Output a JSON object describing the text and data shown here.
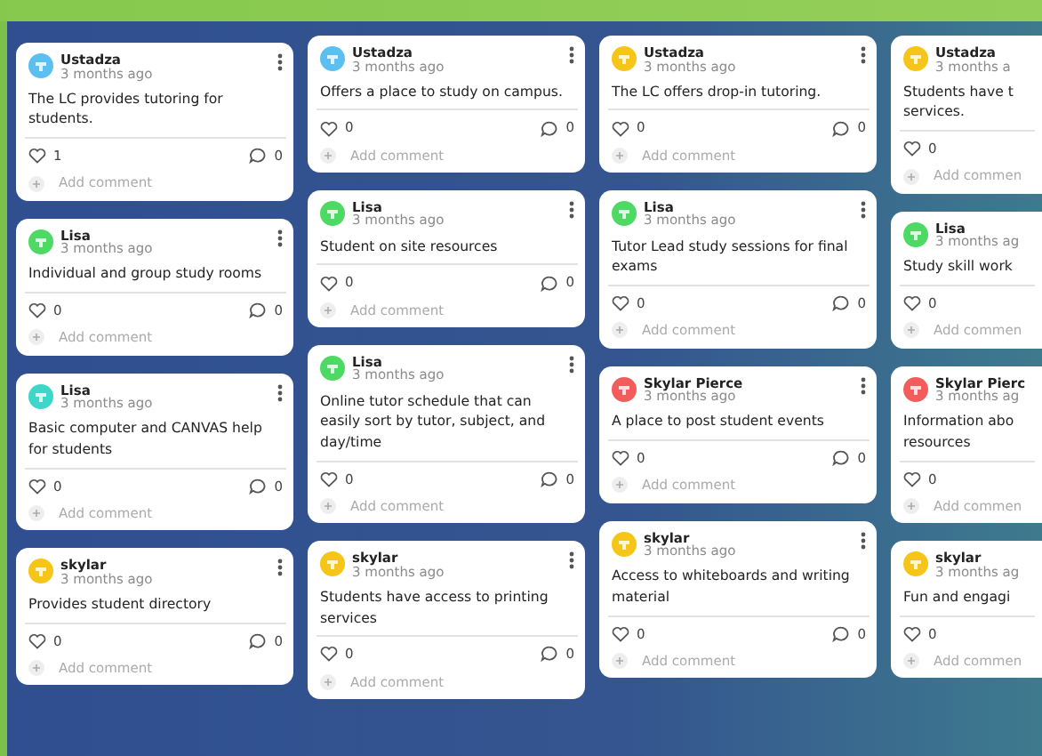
{
  "columns": [
    {
      "posts": [
        {
          "author": "Ustadza",
          "time": "3 months ago",
          "color": "#5bc0f0",
          "text": "The LC provides tutoring for students.",
          "likes": "1",
          "comments": "0",
          "add_comment": "Add comment",
          "menu": true
        },
        {
          "author": "Lisa",
          "time": "3 months ago",
          "color": "#4cd964",
          "text": "Individual and group study rooms",
          "likes": "0",
          "comments": "0",
          "add_comment": "Add comment",
          "menu": true
        },
        {
          "author": "Lisa",
          "time": "3 months ago",
          "color": "#3ed6c8",
          "text": "Basic computer and CANVAS help for students",
          "likes": "0",
          "comments": "0",
          "add_comment": "Add comment",
          "menu": true
        },
        {
          "author": "skylar",
          "time": "3 months ago",
          "color": "#f5c518",
          "text": "Provides student directory",
          "likes": "0",
          "comments": "0",
          "add_comment": "Add comment",
          "menu": true
        }
      ]
    },
    {
      "posts": [
        {
          "author": "Ustadza",
          "time": "3 months ago",
          "color": "#5bc0f0",
          "text": "Offers a place to study on campus.",
          "likes": "0",
          "comments": "0",
          "add_comment": "Add comment",
          "menu": true
        },
        {
          "author": "Lisa",
          "time": "3 months ago",
          "color": "#4cd964",
          "text": "Student on site resources",
          "likes": "0",
          "comments": "0",
          "add_comment": "Add comment",
          "menu": true
        },
        {
          "author": "Lisa",
          "time": "3 months ago",
          "color": "#4cd964",
          "text": "Online tutor schedule that can easily sort by tutor, subject, and day/time",
          "likes": "0",
          "comments": "0",
          "add_comment": "Add comment",
          "menu": true
        },
        {
          "author": "skylar",
          "time": "3 months ago",
          "color": "#f5c518",
          "text": "Students have access to printing services",
          "likes": "0",
          "comments": "0",
          "add_comment": "Add comment",
          "menu": true
        }
      ]
    },
    {
      "posts": [
        {
          "author": "Ustadza",
          "time": "3 months ago",
          "color": "#f5c518",
          "text": "The LC offers drop-in tutoring.",
          "likes": "0",
          "comments": "0",
          "add_comment": "Add comment",
          "menu": true
        },
        {
          "author": "Lisa",
          "time": "3 months ago",
          "color": "#4cd964",
          "text": "Tutor Lead study sessions for final exams",
          "likes": "0",
          "comments": "0",
          "add_comment": "Add comment",
          "menu": true
        },
        {
          "author": "Skylar Pierce",
          "time": "3 months ago",
          "color": "#f25c5c",
          "text": "A place to post student events",
          "likes": "0",
          "comments": "0",
          "add_comment": "Add comment",
          "menu": true
        },
        {
          "author": "skylar",
          "time": "3 months ago",
          "color": "#f5c518",
          "text": "Access to whiteboards and writing material",
          "likes": "0",
          "comments": "0",
          "add_comment": "Add comment",
          "menu": true
        }
      ]
    },
    {
      "posts": [
        {
          "author": "Ustadza",
          "time": "3 months a",
          "color": "#f5c518",
          "text": "Students have t\nservices.",
          "likes": "0",
          "add_comment": "Add commen"
        },
        {
          "author": "Lisa",
          "time": "3 months ag",
          "color": "#4cd964",
          "text": "Study skill work",
          "likes": "0",
          "add_comment": "Add commen"
        },
        {
          "author": "Skylar Pierc",
          "time": "3 months ag",
          "color": "#f25c5c",
          "text": "Information abo\nresources",
          "likes": "0",
          "add_comment": "Add commen"
        },
        {
          "author": "skylar",
          "time": "3 months ag",
          "color": "#f5c518",
          "text": "Fun and engagi",
          "likes": "0",
          "add_comment": "Add commen"
        }
      ]
    }
  ]
}
